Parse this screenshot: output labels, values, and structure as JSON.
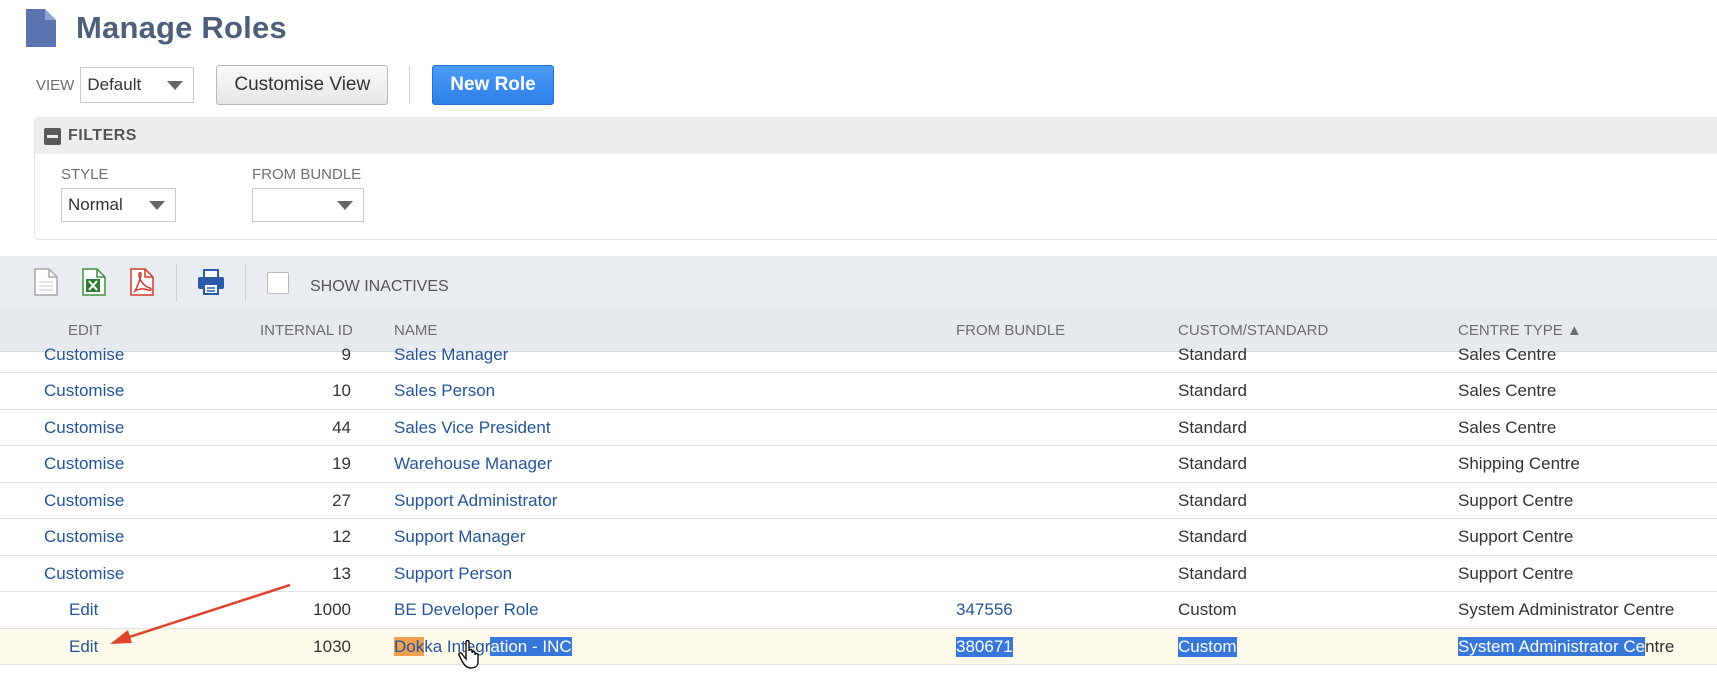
{
  "page": {
    "title": "Manage Roles"
  },
  "view": {
    "label": "VIEW",
    "selected": "Default",
    "customise_label": "Customise View",
    "new_role_label": "New Role"
  },
  "filters": {
    "title": "FILTERS",
    "style": {
      "label": "STYLE",
      "selected": "Normal"
    },
    "from_bundle": {
      "label": "FROM BUNDLE",
      "selected": ""
    }
  },
  "toolbar": {
    "show_inactives_label": "SHOW INACTIVES",
    "show_inactives_checked": false
  },
  "table": {
    "columns": [
      "EDIT",
      "INTERNAL ID",
      "NAME",
      "FROM BUNDLE",
      "CUSTOM/STANDARD",
      "CENTRE TYPE ▲"
    ],
    "rows": [
      {
        "edit": "Customise",
        "id": "9",
        "name": "Sales Manager",
        "bundle": "",
        "custom_standard": "Standard",
        "centre_type": "Sales Centre"
      },
      {
        "edit": "Customise",
        "id": "10",
        "name": "Sales Person",
        "bundle": "",
        "custom_standard": "Standard",
        "centre_type": "Sales Centre"
      },
      {
        "edit": "Customise",
        "id": "44",
        "name": "Sales Vice President",
        "bundle": "",
        "custom_standard": "Standard",
        "centre_type": "Sales Centre"
      },
      {
        "edit": "Customise",
        "id": "19",
        "name": "Warehouse Manager",
        "bundle": "",
        "custom_standard": "Standard",
        "centre_type": "Shipping Centre"
      },
      {
        "edit": "Customise",
        "id": "27",
        "name": "Support Administrator",
        "bundle": "",
        "custom_standard": "Standard",
        "centre_type": "Support Centre"
      },
      {
        "edit": "Customise",
        "id": "12",
        "name": "Support Manager",
        "bundle": "",
        "custom_standard": "Standard",
        "centre_type": "Support Centre"
      },
      {
        "edit": "Customise",
        "id": "13",
        "name": "Support Person",
        "bundle": "",
        "custom_standard": "Standard",
        "centre_type": "Support Centre"
      },
      {
        "edit": "Edit",
        "id": "1000",
        "name": "BE Developer Role",
        "bundle": "347556",
        "custom_standard": "Custom",
        "centre_type": "System Administrator Centre"
      },
      {
        "edit": "Edit",
        "id": "1030",
        "name_part1": "Dok",
        "name_part2": "ka Integr",
        "name_part3": "ation - INC",
        "bundle": "380671",
        "custom_standard": "Custom",
        "centre_type_sel": "System Administrator Ce",
        "centre_type_rest": "ntre"
      }
    ]
  },
  "colors": {
    "title": "#4d5f79",
    "link": "#255599",
    "button_blue": "#2e7fe8",
    "selection": "#3777d9",
    "highlight": "#f0a050",
    "arrow": "#e0432c"
  }
}
